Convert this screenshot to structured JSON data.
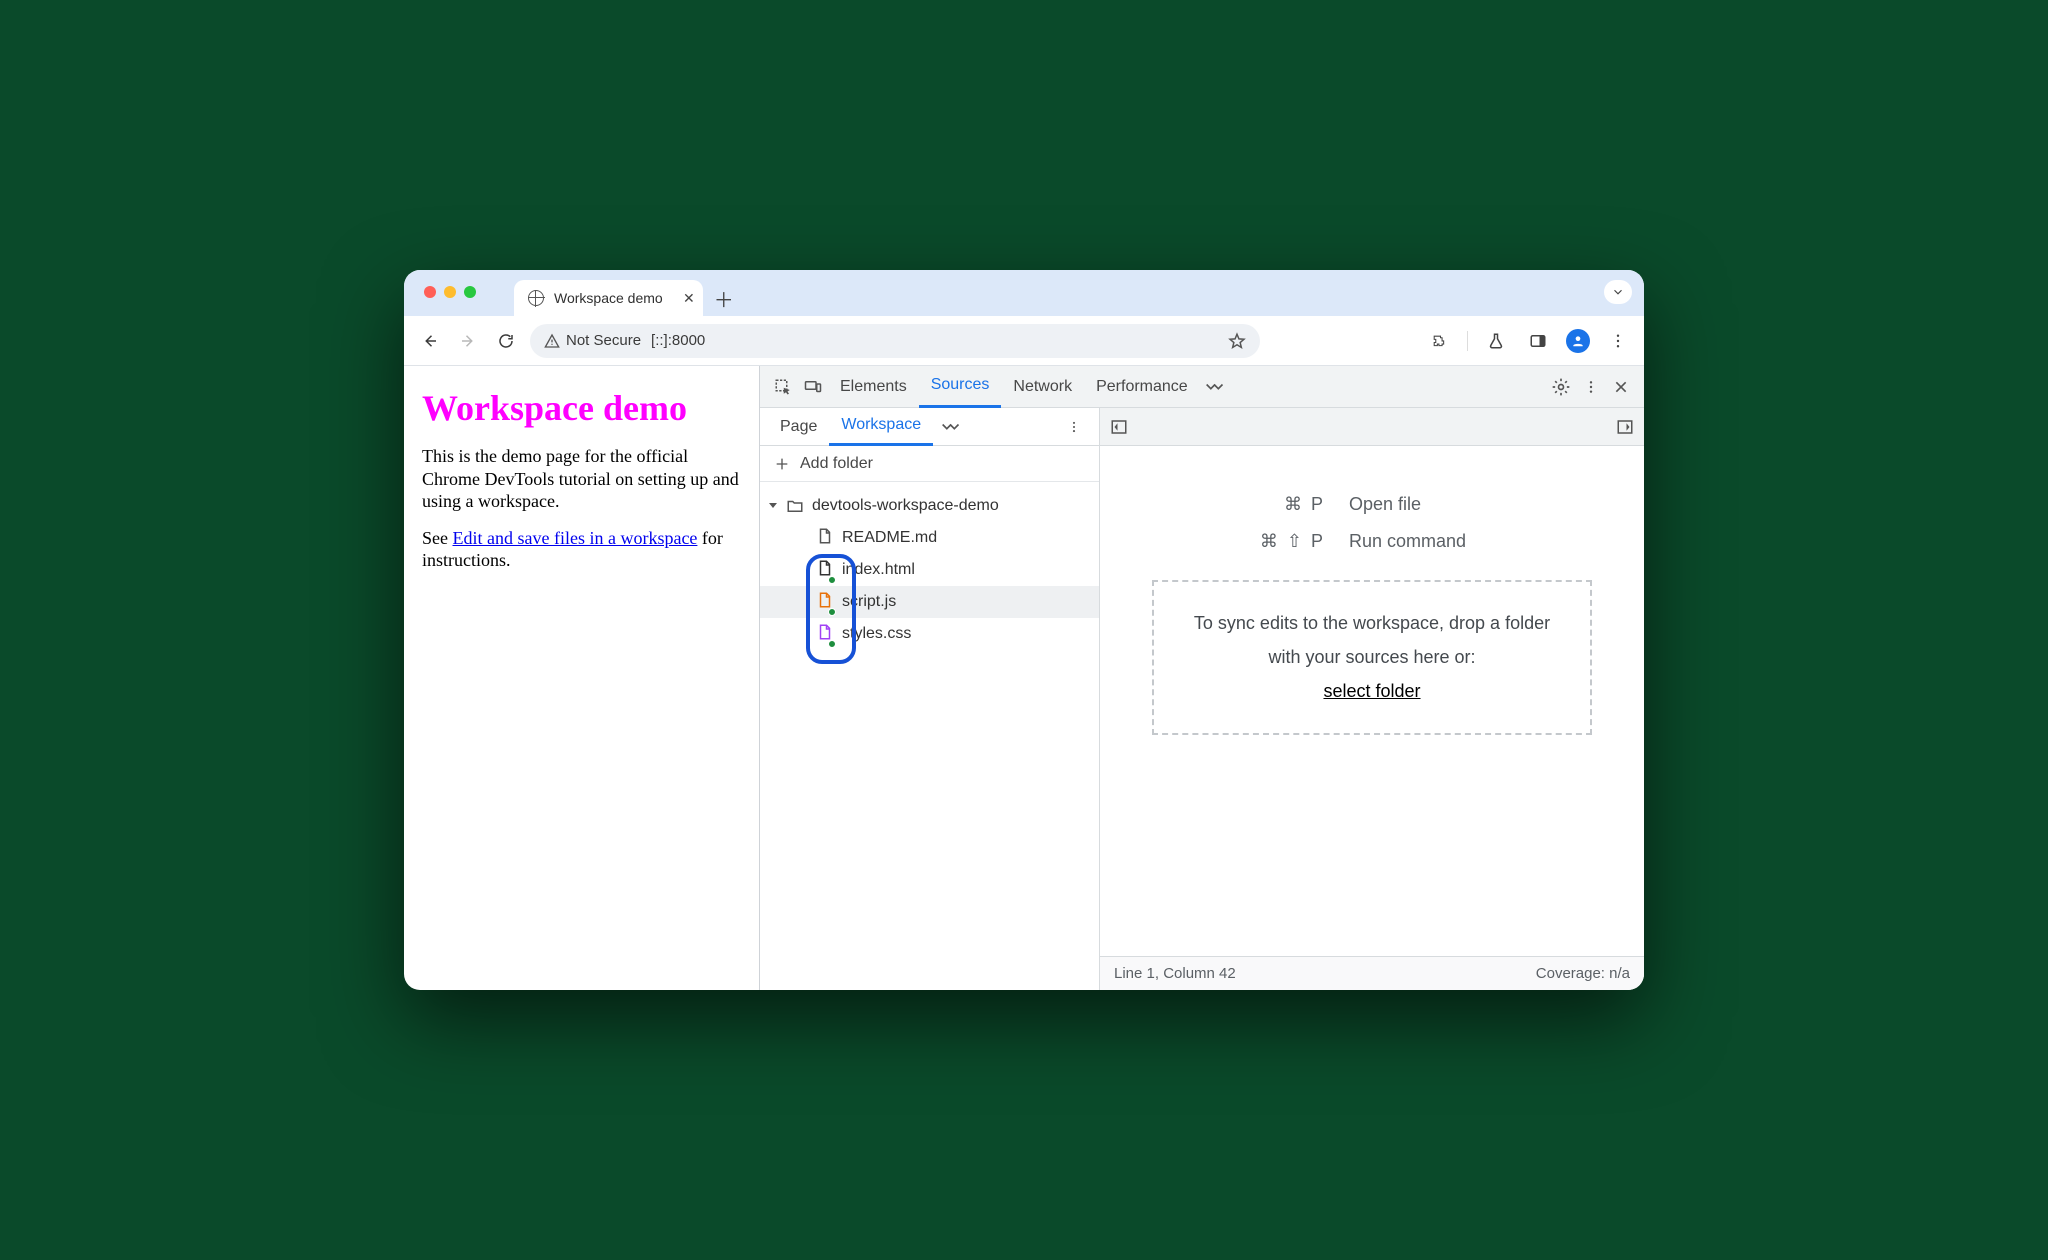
{
  "browser": {
    "tab_title": "Workspace demo",
    "address": {
      "security_label": "Not Secure",
      "url": "[::]:8000"
    }
  },
  "page": {
    "heading": "Workspace demo",
    "p1": "This is the demo page for the official Chrome DevTools tutorial on setting up and using a workspace.",
    "p2_prefix": "See ",
    "p2_link": "Edit and save files in a workspace",
    "p2_suffix": " for instructions."
  },
  "devtools": {
    "panels": {
      "elements": "Elements",
      "sources": "Sources",
      "network": "Network",
      "performance": "Performance"
    },
    "sources_subtabs": {
      "page": "Page",
      "workspace": "Workspace"
    },
    "add_folder": "Add folder",
    "tree": {
      "folder": "devtools-workspace-demo",
      "files": {
        "readme": "README.md",
        "index": "index.html",
        "script": "script.js",
        "styles": "styles.css"
      }
    },
    "shortcuts": {
      "open_file_keys": "⌘ P",
      "open_file_label": "Open file",
      "run_cmd_keys": "⌘ ⇧ P",
      "run_cmd_label": "Run command"
    },
    "dropzone": {
      "line": "To sync edits to the workspace, drop a folder with your sources here or:",
      "link": "select folder"
    },
    "status": {
      "position": "Line 1, Column 42",
      "coverage": "Coverage: n/a"
    }
  }
}
